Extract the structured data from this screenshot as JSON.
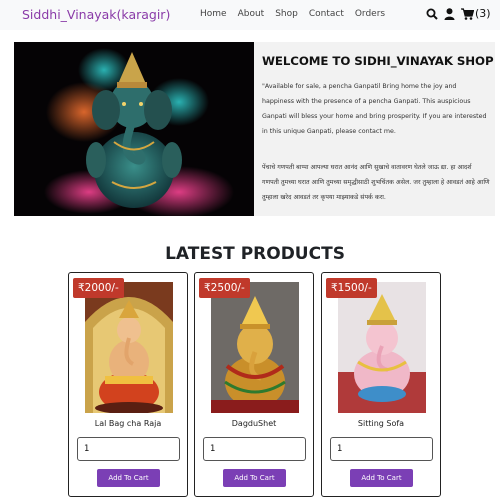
{
  "navbar": {
    "brand": "Siddhi_Vinayak(karagir)",
    "links": [
      "Home",
      "About",
      "Shop",
      "Contact",
      "Orders"
    ],
    "icons": [
      "search-icon",
      "user-icon",
      "cart-icon"
    ],
    "cart_count": "(3)"
  },
  "hero": {
    "title": "WELCOME TO SIDHI_VINAYAK SHOP",
    "description": "\"Available for sale, a pencha Ganpatil Bring home the joy and happiness with the presence of a pencha Ganpati. This auspicious Ganpati will bless your home and bring prosperity. If you are interested in this unique Ganpati, please contact me.",
    "marathi": "पेंचाचे गणपती बाप्पा आपल्या घरात आनंद आणि सुखाचे वातावरण घेतले जाऊ द्या. हा आदर्श गणपती तुमच्या घरात आणि तुमच्या समृद्धीसाठी शुभचिंतक असेल. जर तुम्हाला हे आवडतं आहे आणि तुम्हाला खरेद आवडतं तर कृपया माझ्याकडे संपर्क करा."
  },
  "products_section": {
    "title": "LATEST PRODUCTS"
  },
  "products": [
    {
      "price": "₹2000/-",
      "name": "Lal Bag cha Raja",
      "quantity": "1",
      "button": "Add To Cart"
    },
    {
      "price": "₹2500/-",
      "name": "DagduShet",
      "quantity": "1",
      "button": "Add To Cart"
    },
    {
      "price": "₹1500/-",
      "name": "Sitting Sofa",
      "quantity": "1",
      "button": "Add To Cart"
    }
  ],
  "colors": {
    "brand": "#8a3ba8",
    "button": "#7b3fb5",
    "price_badge": "#c0392b"
  }
}
